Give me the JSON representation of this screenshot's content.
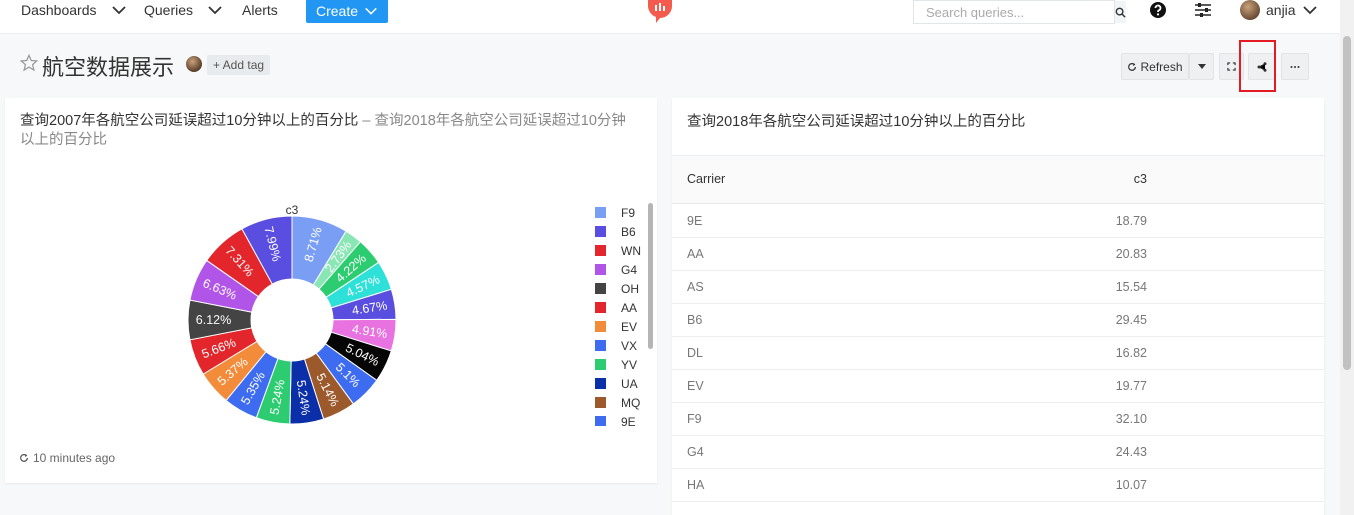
{
  "nav": {
    "dashboards": "Dashboards",
    "queries": "Queries",
    "alerts": "Alerts",
    "create": "Create",
    "search_placeholder": "Search queries...",
    "username": "anjia"
  },
  "header": {
    "title": "航空数据展示",
    "add_tag": "+ Add tag",
    "refresh": "Refresh"
  },
  "widget1": {
    "title": "查询2007年各航空公司延误超过10分钟以上的百分比",
    "separator": " – ",
    "subtitle": "查询2018年各航空公司延误超过10分钟以上的百分比",
    "updated": "10 minutes ago"
  },
  "chart_data": {
    "type": "pie",
    "title": "c3",
    "donut": true,
    "slices": [
      {
        "label": "F9",
        "value": 8.71,
        "color": "#7b9ef5"
      },
      {
        "label": "",
        "value": 2.73,
        "color": "#8ae6b4"
      },
      {
        "label": "",
        "value": 4.22,
        "color": "#2ecc71"
      },
      {
        "label": "",
        "value": 4.57,
        "color": "#2de0d8"
      },
      {
        "label": "",
        "value": 4.67,
        "color": "#5a4ee0"
      },
      {
        "label": "",
        "value": 4.91,
        "color": "#e872e0"
      },
      {
        "label": "",
        "value": 5.04,
        "color": "#050505"
      },
      {
        "label": "",
        "value": 5.1,
        "color": "#3d6cf0"
      },
      {
        "label": "MQ",
        "value": 5.14,
        "color": "#9c5a2c"
      },
      {
        "label": "UA",
        "value": 5.24,
        "color": "#0a2fa8"
      },
      {
        "label": "YV",
        "value": 5.24,
        "color": "#2ecc71"
      },
      {
        "label": "VX",
        "value": 5.35,
        "color": "#3d6cf0"
      },
      {
        "label": "EV",
        "value": 5.37,
        "color": "#f28c3a"
      },
      {
        "label": "AA",
        "value": 5.66,
        "color": "#e2262c"
      },
      {
        "label": "OH",
        "value": 6.12,
        "color": "#444444"
      },
      {
        "label": "G4",
        "value": 6.63,
        "color": "#b055e8"
      },
      {
        "label": "WN",
        "value": 7.31,
        "color": "#e2262c"
      },
      {
        "label": "B6",
        "value": 7.99,
        "color": "#5a4ee0"
      }
    ],
    "slice_labels": [
      "8.71%",
      "2.73%",
      "4.22%",
      "4.57%",
      "4.67%",
      "4.91%",
      "5.04%",
      "5.1%",
      "5.14%",
      "5.24%",
      "5.24%",
      "5.35%",
      "5.37%",
      "5.66%",
      "6.12%",
      "6.63%",
      "7.31%",
      "7.99%"
    ],
    "legend": [
      {
        "label": "F9",
        "color": "#7b9ef5"
      },
      {
        "label": "B6",
        "color": "#5a4ee0"
      },
      {
        "label": "WN",
        "color": "#e2262c"
      },
      {
        "label": "G4",
        "color": "#b055e8"
      },
      {
        "label": "OH",
        "color": "#444444"
      },
      {
        "label": "AA",
        "color": "#e2262c"
      },
      {
        "label": "EV",
        "color": "#f28c3a"
      },
      {
        "label": "VX",
        "color": "#3d6cf0"
      },
      {
        "label": "YV",
        "color": "#2ecc71"
      },
      {
        "label": "UA",
        "color": "#0a2fa8"
      },
      {
        "label": "MQ",
        "color": "#9c5a2c"
      },
      {
        "label": "9E",
        "color": "#3d6cf0"
      }
    ]
  },
  "widget2": {
    "title": "查询2018年各航空公司延误超过10分钟以上的百分比",
    "columns": [
      "Carrier",
      "c3"
    ],
    "rows": [
      {
        "carrier": "9E",
        "c3": "18.79"
      },
      {
        "carrier": "AA",
        "c3": "20.83"
      },
      {
        "carrier": "AS",
        "c3": "15.54"
      },
      {
        "carrier": "B6",
        "c3": "29.45"
      },
      {
        "carrier": "DL",
        "c3": "16.82"
      },
      {
        "carrier": "EV",
        "c3": "19.77"
      },
      {
        "carrier": "F9",
        "c3": "32.10"
      },
      {
        "carrier": "G4",
        "c3": "24.43"
      },
      {
        "carrier": "HA",
        "c3": "10.07"
      }
    ]
  }
}
